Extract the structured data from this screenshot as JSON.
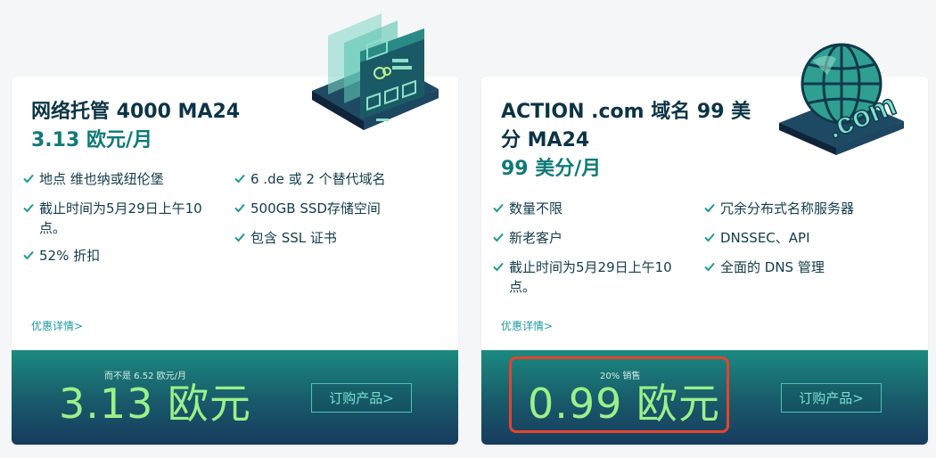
{
  "cards": [
    {
      "title": "网络托管 4000 MA24",
      "subprice": "3.13 欧元/月",
      "features_col1": [
        "地点 维也纳或纽伦堡",
        "截止时间为5月29日上午10点。",
        "52% 折扣"
      ],
      "features_col2": [
        "6 .de 或 2 个替代域名",
        "500GB SSD存储空间",
        "包含 SSL 证书"
      ],
      "details_link": "优惠详情>",
      "footer_note": "而不是 6.52 欧元/月",
      "footer_price": "3.13 欧元",
      "order_button": "订购产品>"
    },
    {
      "title": "ACTION .com 域名 99 美分 MA24",
      "subprice": "99 美分/月",
      "features_col1": [
        "数量不限",
        "新老客户",
        "截止时间为5月29日上午10点。"
      ],
      "features_col2": [
        "冗余分布式名称服务器",
        "DNSSEC、API",
        "全面的 DNS 管理"
      ],
      "details_link": "优惠详情>",
      "footer_note": "20% 销售",
      "footer_price": "0.99 欧元",
      "order_button": "订购产品>",
      "com_label": ".com"
    }
  ],
  "colors": {
    "accent_teal": "#0f7a78",
    "price_green": "#9bf08a",
    "highlight_red": "#e8422a",
    "check_green": "#1f9a8f"
  },
  "icons": [
    "check-icon",
    "web-hosting-illustration",
    "globe-com-illustration"
  ]
}
